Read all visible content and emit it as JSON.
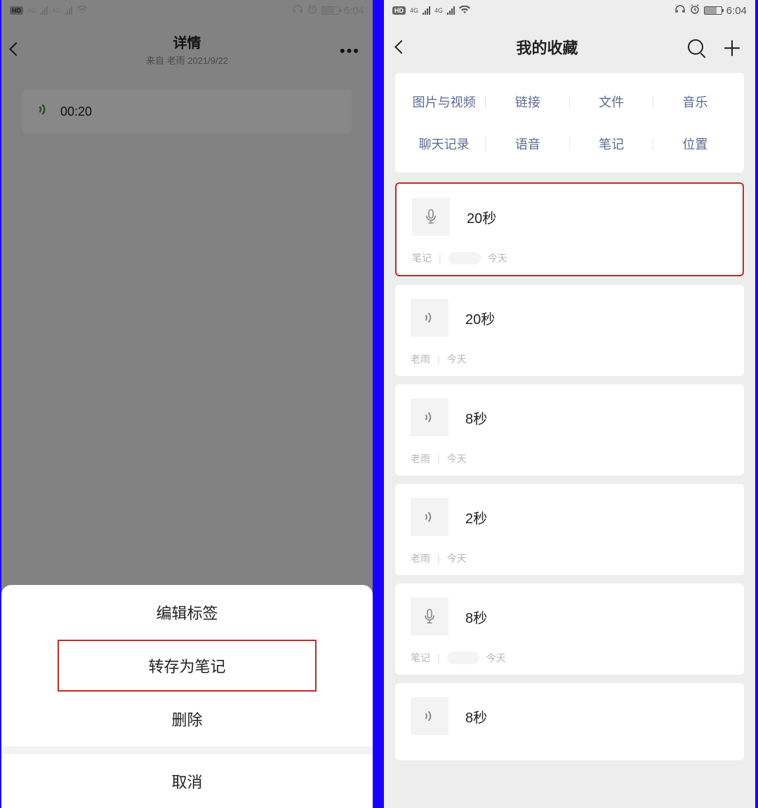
{
  "statusbar": {
    "hd_label": "HD",
    "net_label": "4G",
    "time": "6:04"
  },
  "left": {
    "title": "详情",
    "subtitle": "来自 老雨 2021/9/22",
    "voice_duration": "00:20",
    "sheet": {
      "edit_tag": "编辑标签",
      "save_note": "转存为笔记",
      "delete": "删除",
      "cancel": "取消"
    }
  },
  "right": {
    "title": "我的收藏",
    "categories_row1": [
      "图片与视频",
      "链接",
      "文件",
      "音乐"
    ],
    "categories_row2": [
      "聊天记录",
      "语音",
      "笔记",
      "位置"
    ],
    "items": [
      {
        "icon": "mic",
        "label": "20秒",
        "meta_prefix": "笔记",
        "meta_blur": true,
        "meta_date": "今天",
        "highlight": true
      },
      {
        "icon": "wave",
        "label": "20秒",
        "meta_prefix": "老雨",
        "meta_blur": false,
        "meta_date": "今天",
        "highlight": false
      },
      {
        "icon": "wave",
        "label": "8秒",
        "meta_prefix": "老雨",
        "meta_blur": false,
        "meta_date": "今天",
        "highlight": false
      },
      {
        "icon": "wave",
        "label": "2秒",
        "meta_prefix": "老雨",
        "meta_blur": false,
        "meta_date": "今天",
        "highlight": false
      },
      {
        "icon": "mic",
        "label": "8秒",
        "meta_prefix": "笔记",
        "meta_blur": true,
        "meta_date": "今天",
        "highlight": false
      },
      {
        "icon": "wave",
        "label": "8秒",
        "meta_prefix": "",
        "meta_blur": false,
        "meta_date": "",
        "highlight": false
      }
    ]
  }
}
